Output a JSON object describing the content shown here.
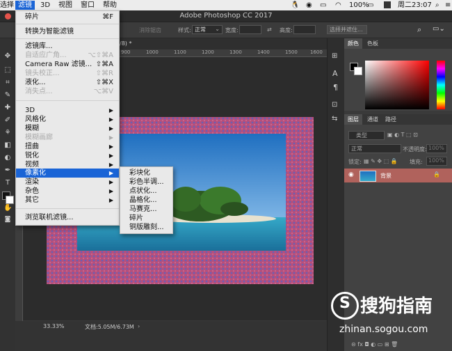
{
  "menubar": {
    "items": [
      "选择",
      "滤镜",
      "3D",
      "视图",
      "窗口",
      "帮助"
    ],
    "battery": "100%",
    "clock": "周二23:07"
  },
  "window": {
    "title": "Adobe Photoshop CC 2017"
  },
  "options_bar": {
    "style_label": "样式:",
    "style_value": "正常",
    "width_label": "宽度:",
    "height_label": "高度:",
    "select_mask_button": "选择并遮住...",
    "antialias_label": "消除锯齿"
  },
  "document": {
    "tab_suffix": "/8) *",
    "ruler_marks": [
      "900",
      "1000",
      "1100",
      "1200",
      "1300",
      "1400",
      "1500",
      "1600"
    ]
  },
  "status_bar": {
    "zoom": "33.33%",
    "doc_size": "文档:5.05M/6.73M"
  },
  "filter_menu": {
    "items": [
      {
        "label": "碎片",
        "shortcut": "⌘F"
      },
      {
        "label": "转换为智能滤镜"
      },
      {
        "label": "滤镜库..."
      },
      {
        "label": "自适应广角...",
        "shortcut": "⌥⇧⌘A",
        "disabled": true
      },
      {
        "label": "Camera Raw 滤镜...",
        "shortcut": "⇧⌘A"
      },
      {
        "label": "镜头校正...",
        "shortcut": "⇧⌘R",
        "disabled": true
      },
      {
        "label": "液化...",
        "shortcut": "⇧⌘X"
      },
      {
        "label": "消失点...",
        "shortcut": "⌥⌘V",
        "disabled": true
      },
      {
        "label": "3D",
        "submenu": true
      },
      {
        "label": "风格化",
        "submenu": true
      },
      {
        "label": "模糊",
        "submenu": true
      },
      {
        "label": "模糊画廊",
        "submenu": true,
        "disabled": true
      },
      {
        "label": "扭曲",
        "submenu": true
      },
      {
        "label": "锐化",
        "submenu": true
      },
      {
        "label": "视频",
        "submenu": true
      },
      {
        "label": "像素化",
        "submenu": true,
        "highlighted": true
      },
      {
        "label": "渲染",
        "submenu": true
      },
      {
        "label": "杂色",
        "submenu": true
      },
      {
        "label": "其它",
        "submenu": true
      },
      {
        "label": "浏览联机滤镜..."
      }
    ]
  },
  "pixelate_submenu": {
    "items": [
      "彩块化",
      "彩色半调...",
      "点状化...",
      "晶格化...",
      "马赛克...",
      "碎片",
      "铜版雕刻..."
    ]
  },
  "color_panel": {
    "tabs": [
      "颜色",
      "色板"
    ]
  },
  "layers_panel": {
    "tabs": [
      "图层",
      "通道",
      "路径"
    ],
    "filter_kind": "类型",
    "blend_mode": "正常",
    "opacity_label": "不透明度:",
    "opacity_value": "100%",
    "lock_label": "锁定:",
    "fill_label": "填充:",
    "fill_value": "100%",
    "layer_name": "背景"
  },
  "watermark": {
    "brand": "搜狗指南",
    "url": "zhinan.sogou.com"
  }
}
